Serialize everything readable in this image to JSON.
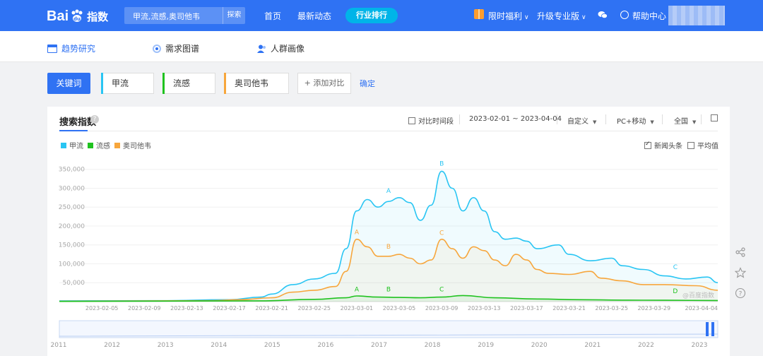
{
  "header": {
    "logo_text": "Bai",
    "logo_suffix": "指数",
    "search_value": "甲流,流感,奥司他韦",
    "search_button": "探索",
    "nav": [
      "首页",
      "最新动态"
    ],
    "rank_button": "行业排行",
    "promo": "限时福利",
    "upgrade": "升级专业版",
    "help": "帮助中心"
  },
  "subnav": {
    "items": [
      "趋势研究",
      "需求图谱",
      "人群画像"
    ]
  },
  "keywords": {
    "label": "关键词",
    "items": [
      {
        "text": "甲流",
        "color": "#29c5f3"
      },
      {
        "text": "流感",
        "color": "#1fc21f"
      },
      {
        "text": "奥司他韦",
        "color": "#f7a63c"
      }
    ],
    "add_label": "+ 添加对比",
    "confirm_label": "确定"
  },
  "panel": {
    "title": "搜索指数",
    "compare_label": "对比时间段",
    "date_range": "2023-02-01 ~ 2023-04-04",
    "custom_label": "自定义",
    "device_label": "PC+移动",
    "region_label": "全国",
    "news_label": "新闻头条",
    "avg_label": "平均值",
    "watermark": "@百度指数"
  },
  "chart_data": {
    "type": "area",
    "x_ticks": [
      "2023-02-05",
      "2023-02-09",
      "2023-02-13",
      "2023-02-17",
      "2023-02-21",
      "2023-02-25",
      "2023-03-01",
      "2023-03-05",
      "2023-03-09",
      "2023-03-13",
      "2023-03-17",
      "2023-03-21",
      "2023-03-25",
      "2023-03-29",
      "2023-04-04"
    ],
    "y_ticks": [
      "50,000",
      "100,000",
      "150,000",
      "200,000",
      "250,000",
      "300,000",
      "350,000"
    ],
    "ylim": [
      0,
      370000
    ],
    "xlim": [
      "2023-02-01",
      "2023-04-04"
    ],
    "legend_placement": "top-left",
    "series": [
      {
        "name": "甲流",
        "color": "#29c5f3",
        "points": [
          [
            "2023-02-01",
            2000
          ],
          [
            "2023-02-10",
            2500
          ],
          [
            "2023-02-17",
            5000
          ],
          [
            "2023-02-20",
            12000
          ],
          [
            "2023-02-21",
            20000
          ],
          [
            "2023-02-23",
            45000
          ],
          [
            "2023-02-25",
            60000
          ],
          [
            "2023-02-27",
            75000
          ],
          [
            "2023-02-28",
            140000
          ],
          [
            "2023-03-01",
            240000
          ],
          [
            "2023-03-02",
            270000
          ],
          [
            "2023-03-03",
            250000
          ],
          [
            "2023-03-04",
            265000
          ],
          [
            "2023-03-05",
            275000
          ],
          [
            "2023-03-06",
            262000
          ],
          [
            "2023-03-07",
            215000
          ],
          [
            "2023-03-08",
            255000
          ],
          [
            "2023-03-09",
            345000
          ],
          [
            "2023-03-10",
            300000
          ],
          [
            "2023-03-11",
            240000
          ],
          [
            "2023-03-12",
            275000
          ],
          [
            "2023-03-13",
            240000
          ],
          [
            "2023-03-14",
            185000
          ],
          [
            "2023-03-15",
            165000
          ],
          [
            "2023-03-16",
            168000
          ],
          [
            "2023-03-17",
            160000
          ],
          [
            "2023-03-18",
            140000
          ],
          [
            "2023-03-20",
            150000
          ],
          [
            "2023-03-21",
            125000
          ],
          [
            "2023-03-23",
            108000
          ],
          [
            "2023-03-25",
            115000
          ],
          [
            "2023-03-26",
            95000
          ],
          [
            "2023-03-28",
            85000
          ],
          [
            "2023-03-30",
            68000
          ],
          [
            "2023-04-01",
            60000
          ],
          [
            "2023-04-03",
            65000
          ],
          [
            "2023-04-04",
            50000
          ]
        ]
      },
      {
        "name": "流感",
        "color": "#1fc21f",
        "points": [
          [
            "2023-02-01",
            500
          ],
          [
            "2023-02-20",
            2000
          ],
          [
            "2023-02-25",
            6000
          ],
          [
            "2023-02-28",
            10000
          ],
          [
            "2023-03-01",
            15000
          ],
          [
            "2023-03-03",
            12000
          ],
          [
            "2023-03-05",
            11000
          ],
          [
            "2023-03-07",
            10000
          ],
          [
            "2023-03-09",
            12000
          ],
          [
            "2023-03-11",
            16000
          ],
          [
            "2023-03-14",
            10000
          ],
          [
            "2023-03-18",
            7000
          ],
          [
            "2023-03-22",
            5000
          ],
          [
            "2023-03-26",
            4000
          ],
          [
            "2023-03-30",
            3500
          ],
          [
            "2023-04-04",
            3000
          ]
        ]
      },
      {
        "name": "奥司他韦",
        "color": "#f7a63c",
        "points": [
          [
            "2023-02-01",
            1000
          ],
          [
            "2023-02-15",
            2500
          ],
          [
            "2023-02-18",
            5000
          ],
          [
            "2023-02-21",
            10000
          ],
          [
            "2023-02-23",
            25000
          ],
          [
            "2023-02-25",
            30000
          ],
          [
            "2023-02-27",
            40000
          ],
          [
            "2023-02-28",
            80000
          ],
          [
            "2023-03-01",
            165000
          ],
          [
            "2023-03-02",
            145000
          ],
          [
            "2023-03-03",
            120000
          ],
          [
            "2023-03-04",
            120000
          ],
          [
            "2023-03-05",
            125000
          ],
          [
            "2023-03-06",
            115000
          ],
          [
            "2023-03-07",
            100000
          ],
          [
            "2023-03-08",
            110000
          ],
          [
            "2023-03-09",
            165000
          ],
          [
            "2023-03-10",
            140000
          ],
          [
            "2023-03-11",
            115000
          ],
          [
            "2023-03-12",
            145000
          ],
          [
            "2023-03-13",
            135000
          ],
          [
            "2023-03-14",
            110000
          ],
          [
            "2023-03-15",
            95000
          ],
          [
            "2023-03-16",
            125000
          ],
          [
            "2023-03-17",
            110000
          ],
          [
            "2023-03-18",
            85000
          ],
          [
            "2023-03-19",
            75000
          ],
          [
            "2023-03-21",
            72000
          ],
          [
            "2023-03-23",
            80000
          ],
          [
            "2023-03-24",
            62000
          ],
          [
            "2023-03-26",
            55000
          ],
          [
            "2023-03-28",
            45000
          ],
          [
            "2023-03-30",
            45000
          ],
          [
            "2023-04-02",
            42000
          ],
          [
            "2023-04-04",
            30000
          ]
        ]
      }
    ],
    "annotations": [
      {
        "label": "A",
        "x": "2023-03-04",
        "y": 288000,
        "color": "#29c5f3"
      },
      {
        "label": "B",
        "x": "2023-03-09",
        "y": 360000,
        "color": "#29c5f3"
      },
      {
        "label": "C",
        "x": "2023-03-31",
        "y": 86000,
        "color": "#29c5f3"
      },
      {
        "label": "A",
        "x": "2023-03-01",
        "y": 178000,
        "color": "#f7a63c"
      },
      {
        "label": "B",
        "x": "2023-03-04",
        "y": 140000,
        "color": "#f7a63c"
      },
      {
        "label": "C",
        "x": "2023-03-09",
        "y": 177000,
        "color": "#f7a63c"
      },
      {
        "label": "A",
        "x": "2023-03-01",
        "y": 27000,
        "color": "#1fc21f"
      },
      {
        "label": "B",
        "x": "2023-03-04",
        "y": 27000,
        "color": "#1fc21f"
      },
      {
        "label": "C",
        "x": "2023-03-09",
        "y": 27000,
        "color": "#1fc21f"
      },
      {
        "label": "D",
        "x": "2023-03-31",
        "y": 22000,
        "color": "#1fc21f"
      }
    ],
    "timeline_years": [
      "2011",
      "2012",
      "2013",
      "2014",
      "2015",
      "2016",
      "2017",
      "2018",
      "2019",
      "2020",
      "2021",
      "2022",
      "2023"
    ]
  }
}
